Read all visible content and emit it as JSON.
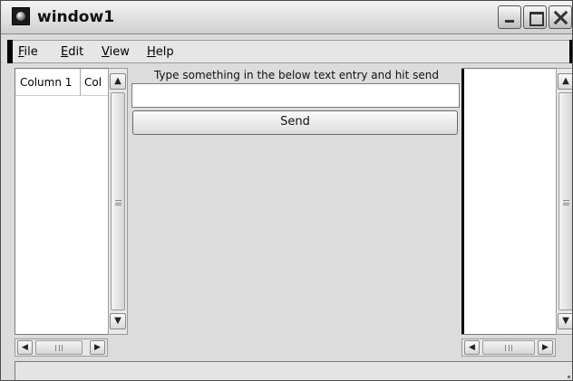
{
  "window": {
    "title": "window1"
  },
  "menubar": {
    "items": [
      {
        "mnemonic": "F",
        "rest": "ile"
      },
      {
        "mnemonic": "E",
        "rest": "dit"
      },
      {
        "mnemonic": "V",
        "rest": "iew"
      },
      {
        "mnemonic": "H",
        "rest": "elp"
      }
    ]
  },
  "left_list": {
    "columns": [
      "Column 1",
      "Col"
    ]
  },
  "center": {
    "instruction": "Type something in the below text entry and hit send",
    "entry_value": "",
    "send_label": "Send"
  },
  "icons": {
    "app": "app-icon",
    "minimize": "minimize-icon",
    "maximize": "maximize-icon",
    "close": "close-icon",
    "scroll_up": "chevron-up-icon",
    "scroll_down": "chevron-down-icon",
    "scroll_left": "chevron-left-icon",
    "scroll_right": "chevron-right-icon"
  },
  "glyphs": {
    "up": "▲",
    "down": "▼",
    "left": "◀",
    "right": "▶"
  }
}
